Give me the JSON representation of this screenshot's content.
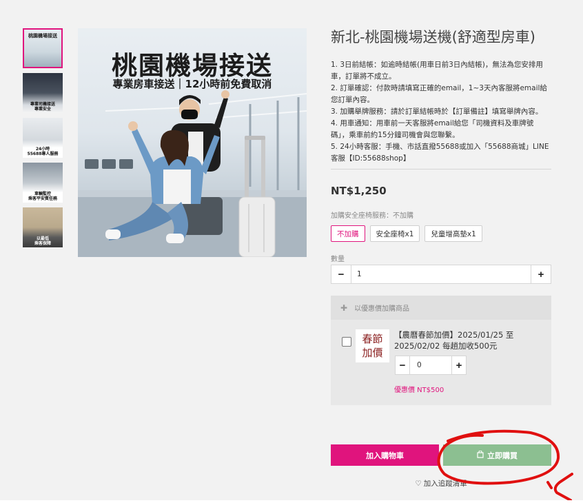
{
  "thumbnails": [
    {
      "caption": "桃園機場接送"
    },
    {
      "caption": "專業司機接送\n專業安全"
    },
    {
      "caption": "24小時\n55688專人服務"
    },
    {
      "caption": "車輛監控\n乘客平安賓任務"
    },
    {
      "caption": "以最低\n乘客保障"
    }
  ],
  "main_image": {
    "title": "桃園機場接送",
    "subtitle": "專業房車接送｜12小時前免費取消"
  },
  "product": {
    "title": "新北-桃園機場送機(舒適型房車)",
    "notes": [
      "1. 3日前結帳：如逾時結帳(用車日前3日內結帳)，無法為您安排用車，訂單將不成立。",
      "2. 訂單確認：付款時請填寫正確的email，1~3天內客服將email給您訂單內容。",
      "3. 加購舉牌服務：請於訂單結帳時於【訂單備註】填寫舉牌內容。",
      "4. 用車通知：用車前一天客服將email給您「司機資料及車牌號碼」，乘車前約15分鐘司機會與您聯繫。",
      "5. 24小時客服：手機、市話直撥55688或加入「55688商城」LINE客服【ID:55688shop】"
    ],
    "price": "NT$1,250"
  },
  "seat_option": {
    "label": "加購安全座椅服務：不加購",
    "options": [
      "不加購",
      "安全座椅x1",
      "兒童增高墊x1"
    ],
    "selected": "不加購"
  },
  "quantity": {
    "label": "數量",
    "value": "1",
    "minus": "−",
    "plus": "+"
  },
  "addon": {
    "header": "以優惠價加購商品",
    "image_text_line1": "春節",
    "image_text_line2": "加價",
    "title": "【農曆春節加價】2025/01/25 至 2025/02/02 每趟加收500元",
    "qty_value": "0",
    "price": "優惠價 NT$500"
  },
  "actions": {
    "add_to_cart": "加入購物車",
    "buy_now": "立即購買",
    "wishlist": "加入追蹤清單"
  },
  "colors": {
    "accent": "#e0147d",
    "buy_button": "#8cbf91",
    "annotation": "#e01010"
  },
  "icons": {
    "plus": "plus-icon",
    "minus": "minus-icon",
    "bag": "shopping-bag-icon",
    "heart": "heart-icon"
  }
}
